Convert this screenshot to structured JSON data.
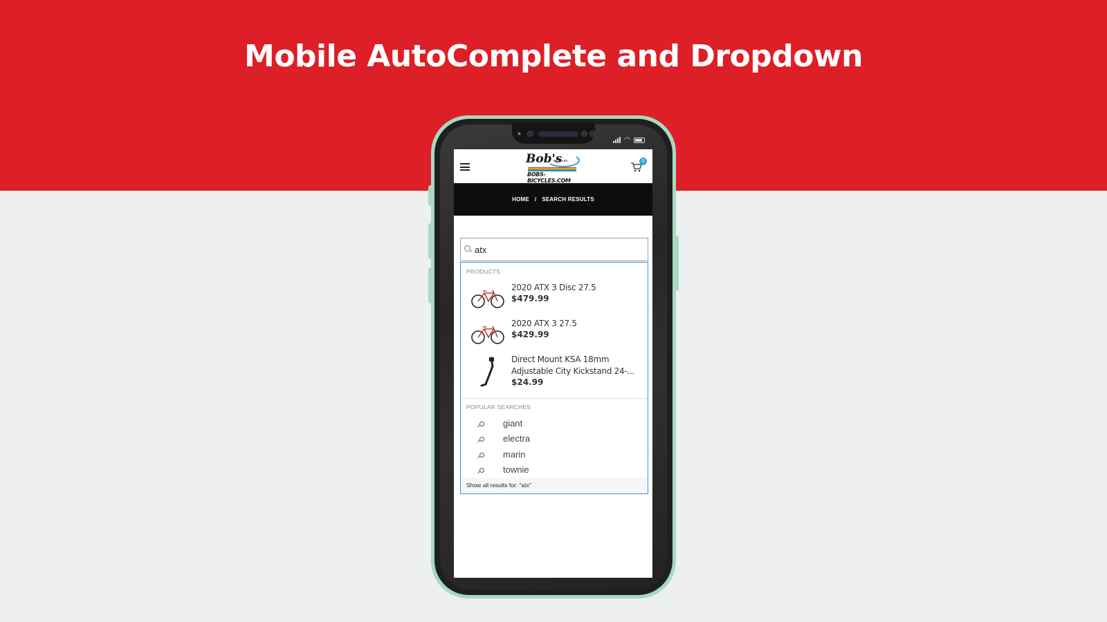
{
  "headline": "Mobile AutoComplete and Dropdown",
  "colors": {
    "brand_red": "#dd1f27",
    "phone_frame": "#a8d9c2",
    "dropdown_border": "#3a8fd6",
    "cart_badge": "#29a8e0"
  },
  "site": {
    "logo_text": "Bob's",
    "logo_sub": "BICYCLES",
    "logo_url": "BOBS-BICYCLES.COM",
    "cart_count": "0",
    "breadcrumb": {
      "home": "HOME",
      "separator": "/",
      "current": "SEARCH RESULTS"
    }
  },
  "search": {
    "value": "atx"
  },
  "autocomplete": {
    "products_label": "PRODUCTS",
    "products": [
      {
        "name": "2020 ATX 3 Disc 27.5",
        "price": "$479.99",
        "icon": "bicycle-icon"
      },
      {
        "name": "2020 ATX 3 27.5",
        "price": "$429.99",
        "icon": "bicycle-icon"
      },
      {
        "name": "Direct Mount KSA 18mm Adjustable City Kickstand 24-...",
        "price": "$24.99",
        "icon": "kickstand-icon"
      }
    ],
    "popular_label": "POPULAR SEARCHES",
    "popular": [
      "giant",
      "electra",
      "marin",
      "townie"
    ],
    "show_all": "Show all results for: \"atx\""
  }
}
